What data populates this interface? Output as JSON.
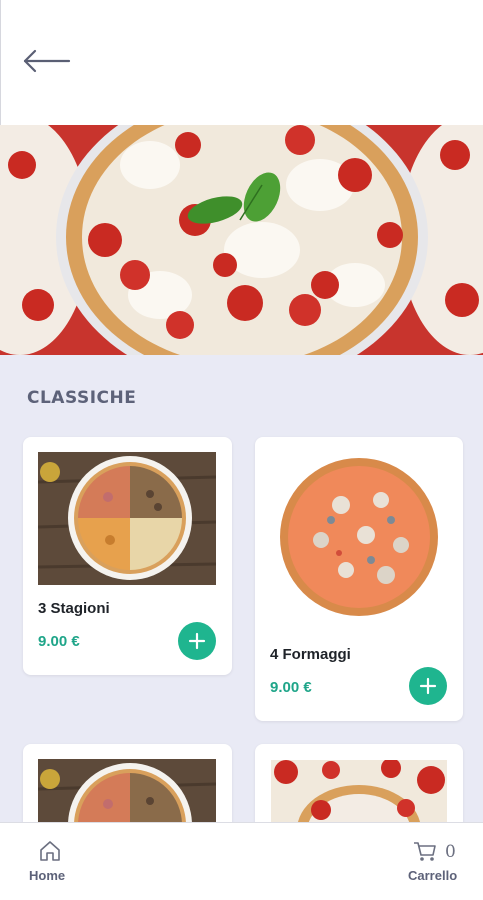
{
  "colors": {
    "accent": "#1fb58f",
    "price": "#1fa589",
    "background": "#e9eaf5",
    "label": "#5d6279"
  },
  "header": {
    "back_icon": "arrow-left-icon"
  },
  "section": {
    "title": "CLASSICHE"
  },
  "products": [
    {
      "name": "3 Stagioni",
      "price": "9.00 €",
      "image": "quattro-stagioni-pizza-photo"
    },
    {
      "name": "4 Formaggi",
      "price": "9.00 €",
      "image": "quattro-formaggi-pizza-photo"
    },
    {
      "name": "",
      "price": "",
      "image": "quattro-stagioni-pizza-photo"
    },
    {
      "name": "",
      "price": "",
      "image": "margherita-pizza-photo"
    }
  ],
  "bottom_nav": {
    "home_label": "Home",
    "home_icon": "home-icon",
    "cart_label": "Carrello",
    "cart_icon": "cart-icon",
    "cart_count": "0"
  }
}
